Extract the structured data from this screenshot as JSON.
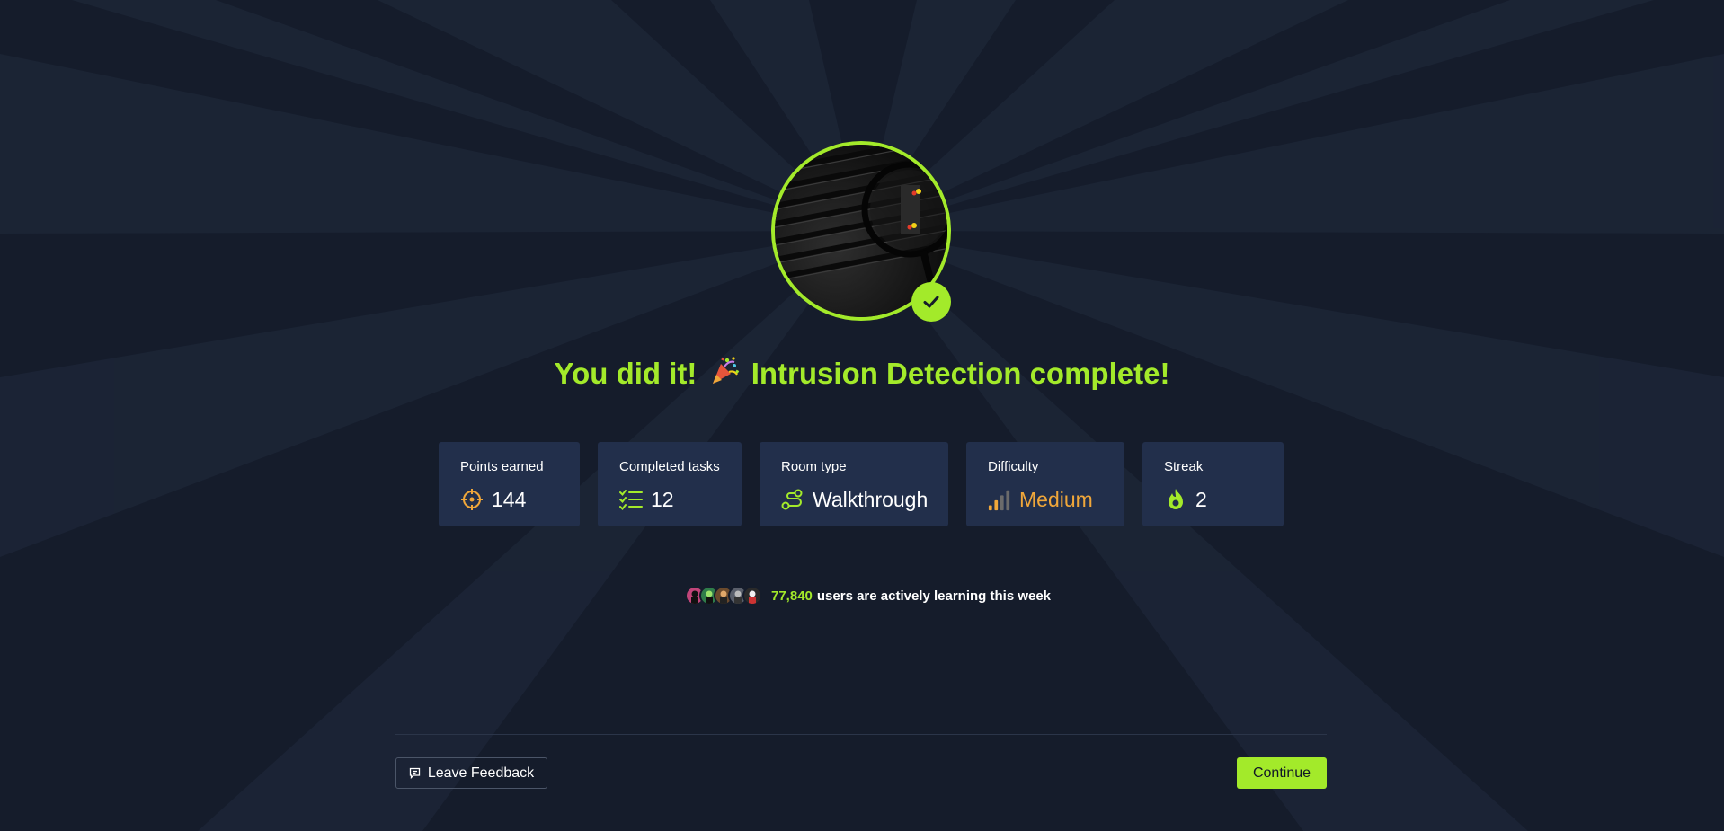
{
  "headline": {
    "prefix": "You did it!",
    "room_name": "Intrusion Detection complete!"
  },
  "stats": {
    "points": {
      "label": "Points earned",
      "value": "144",
      "icon": "target-icon"
    },
    "tasks": {
      "label": "Completed tasks",
      "value": "12",
      "icon": "checklist-icon"
    },
    "room_type": {
      "label": "Room type",
      "value": "Walkthrough",
      "icon": "route-icon"
    },
    "difficulty": {
      "label": "Difficulty",
      "value": "Medium",
      "icon": "signal-bars-icon"
    },
    "streak": {
      "label": "Streak",
      "value": "2",
      "icon": "flame-icon"
    }
  },
  "learners": {
    "count": "77,840",
    "text": "users are actively learning this week"
  },
  "footer": {
    "feedback_label": "Leave Feedback",
    "continue_label": "Continue"
  },
  "colors": {
    "accent": "#a3ea2a",
    "background": "#151c2b",
    "card": "#222f4b",
    "medium": "#f0a73a"
  }
}
